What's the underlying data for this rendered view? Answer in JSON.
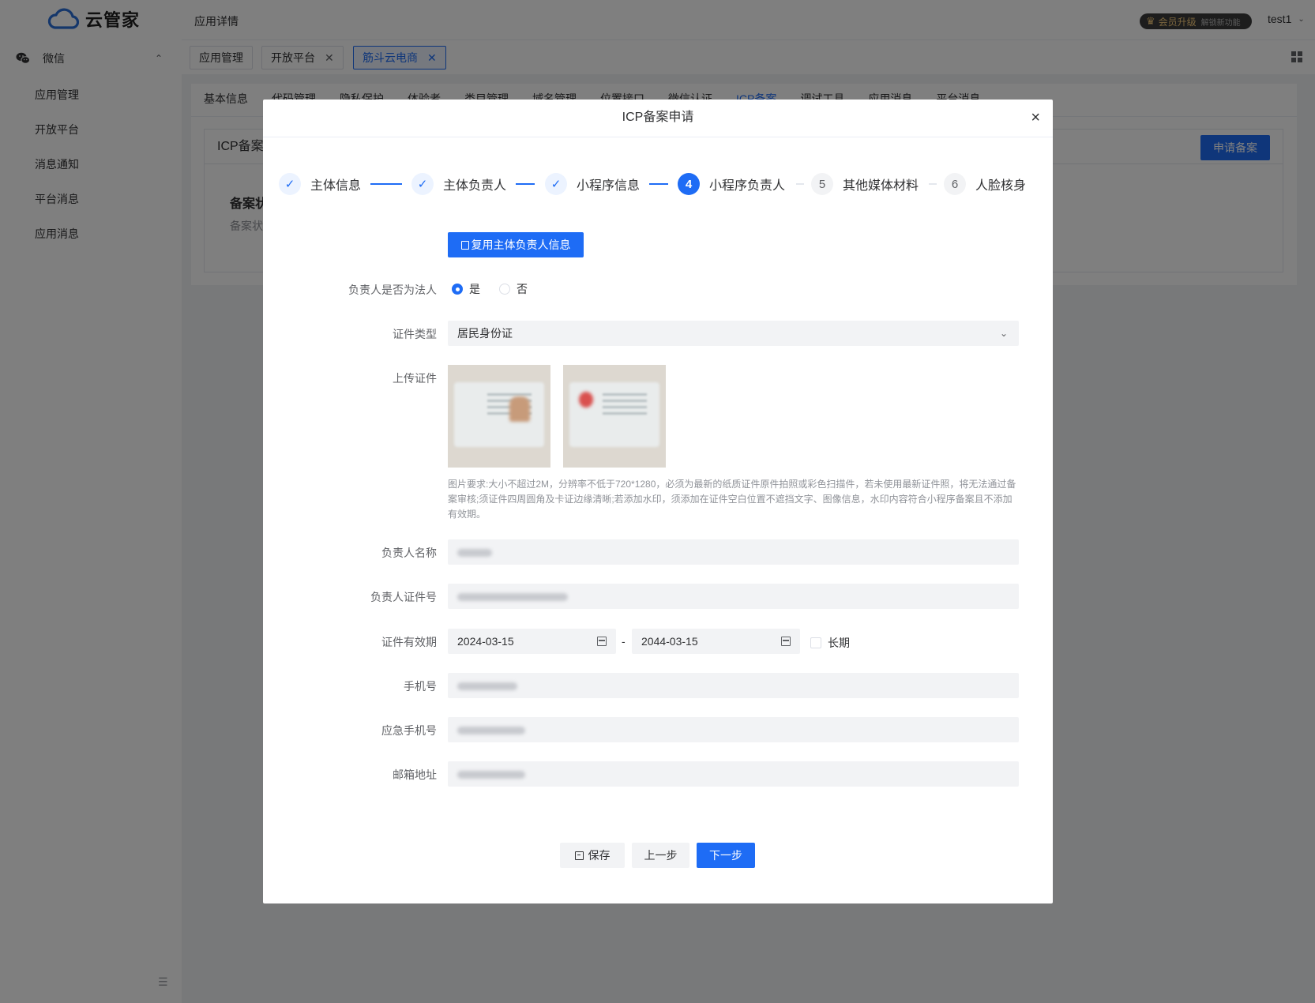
{
  "app": {
    "logo_text": "云管家",
    "page_title": "应用详情"
  },
  "header": {
    "vip_label": "会员升级",
    "vip_sub": "解锁新功能",
    "username": "test1"
  },
  "sidebar": {
    "group_label": "微信",
    "items": [
      "应用管理",
      "开放平台",
      "消息通知",
      "平台消息",
      "应用消息"
    ]
  },
  "tabs": [
    {
      "label": "应用管理",
      "closable": false,
      "active": false
    },
    {
      "label": "开放平台",
      "closable": true,
      "active": false
    },
    {
      "label": "筋斗云电商",
      "closable": true,
      "active": true
    }
  ],
  "subtabs": [
    "基本信息",
    "代码管理",
    "隐私保护",
    "体验者",
    "类目管理",
    "域名管理",
    "位置接口",
    "微信认证",
    "ICP备案",
    "调试工具",
    "应用消息",
    "平台消息"
  ],
  "icp_card": {
    "title": "ICP备案",
    "apply_button": "申请备案",
    "status_title": "备案状态",
    "status_sub": "备案状态"
  },
  "modal": {
    "title": "ICP备案申请",
    "close": "×",
    "steps": [
      {
        "label": "主体信息",
        "state": "done"
      },
      {
        "label": "主体负责人",
        "state": "done"
      },
      {
        "label": "小程序信息",
        "state": "done"
      },
      {
        "number": "4",
        "label": "小程序负责人",
        "state": "current"
      },
      {
        "number": "5",
        "label": "其他媒体材料",
        "state": "todo"
      },
      {
        "number": "6",
        "label": "人脸核身",
        "state": "todo"
      }
    ],
    "reuse_button": "复用主体负责人信息",
    "form": {
      "is_legal_label": "负责人是否为法人",
      "yes": "是",
      "no": "否",
      "id_type_label": "证件类型",
      "id_type_value": "居民身份证",
      "upload_label": "上传证件",
      "hint": "图片要求:大小不超过2M，分辨率不低于720*1280，必须为最新的纸质证件原件拍照或彩色扫描件，若未使用最新证件照，将无法通过备案审核;须证件四周圆角及卡证边缘清晰;若添加水印，须添加在证件空白位置不遮挡文字、图像信息，水印内容符合小程序备案且不添加有效期。",
      "name_label": "负责人名称",
      "id_number_label": "负责人证件号",
      "validity_label": "证件有效期",
      "validity_start": "2024-03-15",
      "validity_end": "2044-03-15",
      "validity_sep": "-",
      "long_term": "长期",
      "phone_label": "手机号",
      "emergency_phone_label": "应急手机号",
      "email_label": "邮箱地址"
    },
    "buttons": {
      "save": "保存",
      "prev": "上一步",
      "next": "下一步"
    }
  },
  "colors": {
    "primary": "#1e6cf5",
    "overlay": "rgba(0,0,0,0.5)"
  }
}
